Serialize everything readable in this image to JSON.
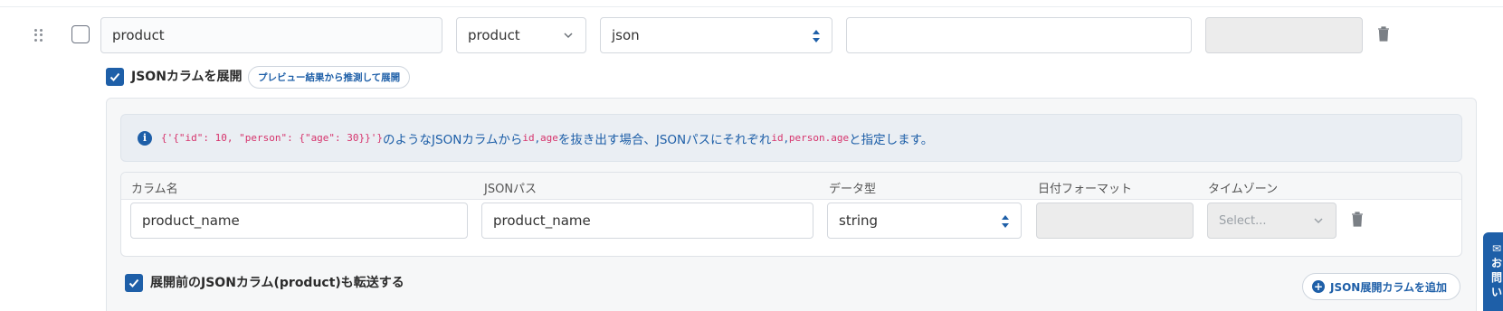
{
  "row": {
    "name_value": "product",
    "source_select": "product",
    "type_select": "json",
    "field4_value": "",
    "field5_value": ""
  },
  "json_expand": {
    "label": "JSONカラムを展開",
    "infer_button": "プレビュー結果から推測して展開",
    "info": {
      "example_code": "{'{\"id\": 10, \"person\": {\"age\": 30}}'}",
      "text1": "のようなJSONカラムから ",
      "key1": "id",
      "key2": "age",
      "text2": "を抜き出す場合、JSONパスにそれぞれ ",
      "path1": "id",
      "path2": "person.age",
      "text3": " と指定します。"
    },
    "columns": [
      "カラム名",
      "JSONパス",
      "データ型",
      "日付フォーマット",
      "タイムゾーン"
    ],
    "rows": [
      {
        "column_name": "product_name",
        "json_path": "product_name",
        "data_type": "string",
        "date_format": "",
        "timezone_placeholder": "Select..."
      }
    ],
    "keep_original_label": "展開前のJSONカラム(product)も転送する",
    "add_button": "JSON展開カラムを追加"
  },
  "contact_tab": {
    "chars": [
      "✉",
      "お",
      "問",
      "い"
    ]
  },
  "colors": {
    "accent": "#1e5fa8",
    "code": "#d6336c"
  }
}
